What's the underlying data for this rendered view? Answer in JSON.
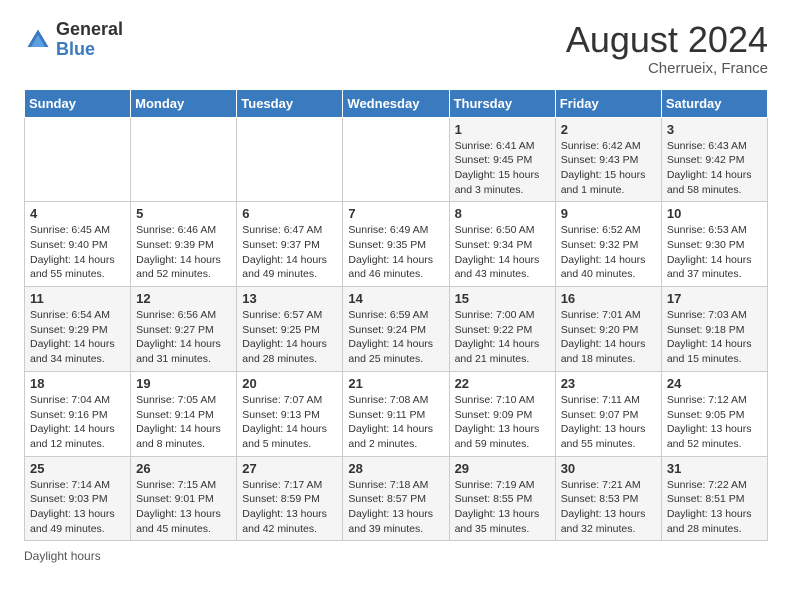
{
  "header": {
    "logo_general": "General",
    "logo_blue": "Blue",
    "month_year": "August 2024",
    "location": "Cherrueix, France"
  },
  "days_of_week": [
    "Sunday",
    "Monday",
    "Tuesday",
    "Wednesday",
    "Thursday",
    "Friday",
    "Saturday"
  ],
  "weeks": [
    [
      {
        "day": "",
        "info": ""
      },
      {
        "day": "",
        "info": ""
      },
      {
        "day": "",
        "info": ""
      },
      {
        "day": "",
        "info": ""
      },
      {
        "day": "1",
        "info": "Sunrise: 6:41 AM\nSunset: 9:45 PM\nDaylight: 15 hours\nand 3 minutes."
      },
      {
        "day": "2",
        "info": "Sunrise: 6:42 AM\nSunset: 9:43 PM\nDaylight: 15 hours\nand 1 minute."
      },
      {
        "day": "3",
        "info": "Sunrise: 6:43 AM\nSunset: 9:42 PM\nDaylight: 14 hours\nand 58 minutes."
      }
    ],
    [
      {
        "day": "4",
        "info": "Sunrise: 6:45 AM\nSunset: 9:40 PM\nDaylight: 14 hours\nand 55 minutes."
      },
      {
        "day": "5",
        "info": "Sunrise: 6:46 AM\nSunset: 9:39 PM\nDaylight: 14 hours\nand 52 minutes."
      },
      {
        "day": "6",
        "info": "Sunrise: 6:47 AM\nSunset: 9:37 PM\nDaylight: 14 hours\nand 49 minutes."
      },
      {
        "day": "7",
        "info": "Sunrise: 6:49 AM\nSunset: 9:35 PM\nDaylight: 14 hours\nand 46 minutes."
      },
      {
        "day": "8",
        "info": "Sunrise: 6:50 AM\nSunset: 9:34 PM\nDaylight: 14 hours\nand 43 minutes."
      },
      {
        "day": "9",
        "info": "Sunrise: 6:52 AM\nSunset: 9:32 PM\nDaylight: 14 hours\nand 40 minutes."
      },
      {
        "day": "10",
        "info": "Sunrise: 6:53 AM\nSunset: 9:30 PM\nDaylight: 14 hours\nand 37 minutes."
      }
    ],
    [
      {
        "day": "11",
        "info": "Sunrise: 6:54 AM\nSunset: 9:29 PM\nDaylight: 14 hours\nand 34 minutes."
      },
      {
        "day": "12",
        "info": "Sunrise: 6:56 AM\nSunset: 9:27 PM\nDaylight: 14 hours\nand 31 minutes."
      },
      {
        "day": "13",
        "info": "Sunrise: 6:57 AM\nSunset: 9:25 PM\nDaylight: 14 hours\nand 28 minutes."
      },
      {
        "day": "14",
        "info": "Sunrise: 6:59 AM\nSunset: 9:24 PM\nDaylight: 14 hours\nand 25 minutes."
      },
      {
        "day": "15",
        "info": "Sunrise: 7:00 AM\nSunset: 9:22 PM\nDaylight: 14 hours\nand 21 minutes."
      },
      {
        "day": "16",
        "info": "Sunrise: 7:01 AM\nSunset: 9:20 PM\nDaylight: 14 hours\nand 18 minutes."
      },
      {
        "day": "17",
        "info": "Sunrise: 7:03 AM\nSunset: 9:18 PM\nDaylight: 14 hours\nand 15 minutes."
      }
    ],
    [
      {
        "day": "18",
        "info": "Sunrise: 7:04 AM\nSunset: 9:16 PM\nDaylight: 14 hours\nand 12 minutes."
      },
      {
        "day": "19",
        "info": "Sunrise: 7:05 AM\nSunset: 9:14 PM\nDaylight: 14 hours\nand 8 minutes."
      },
      {
        "day": "20",
        "info": "Sunrise: 7:07 AM\nSunset: 9:13 PM\nDaylight: 14 hours\nand 5 minutes."
      },
      {
        "day": "21",
        "info": "Sunrise: 7:08 AM\nSunset: 9:11 PM\nDaylight: 14 hours\nand 2 minutes."
      },
      {
        "day": "22",
        "info": "Sunrise: 7:10 AM\nSunset: 9:09 PM\nDaylight: 13 hours\nand 59 minutes."
      },
      {
        "day": "23",
        "info": "Sunrise: 7:11 AM\nSunset: 9:07 PM\nDaylight: 13 hours\nand 55 minutes."
      },
      {
        "day": "24",
        "info": "Sunrise: 7:12 AM\nSunset: 9:05 PM\nDaylight: 13 hours\nand 52 minutes."
      }
    ],
    [
      {
        "day": "25",
        "info": "Sunrise: 7:14 AM\nSunset: 9:03 PM\nDaylight: 13 hours\nand 49 minutes."
      },
      {
        "day": "26",
        "info": "Sunrise: 7:15 AM\nSunset: 9:01 PM\nDaylight: 13 hours\nand 45 minutes."
      },
      {
        "day": "27",
        "info": "Sunrise: 7:17 AM\nSunset: 8:59 PM\nDaylight: 13 hours\nand 42 minutes."
      },
      {
        "day": "28",
        "info": "Sunrise: 7:18 AM\nSunset: 8:57 PM\nDaylight: 13 hours\nand 39 minutes."
      },
      {
        "day": "29",
        "info": "Sunrise: 7:19 AM\nSunset: 8:55 PM\nDaylight: 13 hours\nand 35 minutes."
      },
      {
        "day": "30",
        "info": "Sunrise: 7:21 AM\nSunset: 8:53 PM\nDaylight: 13 hours\nand 32 minutes."
      },
      {
        "day": "31",
        "info": "Sunrise: 7:22 AM\nSunset: 8:51 PM\nDaylight: 13 hours\nand 28 minutes."
      }
    ]
  ],
  "footer": {
    "label": "Daylight hours"
  }
}
